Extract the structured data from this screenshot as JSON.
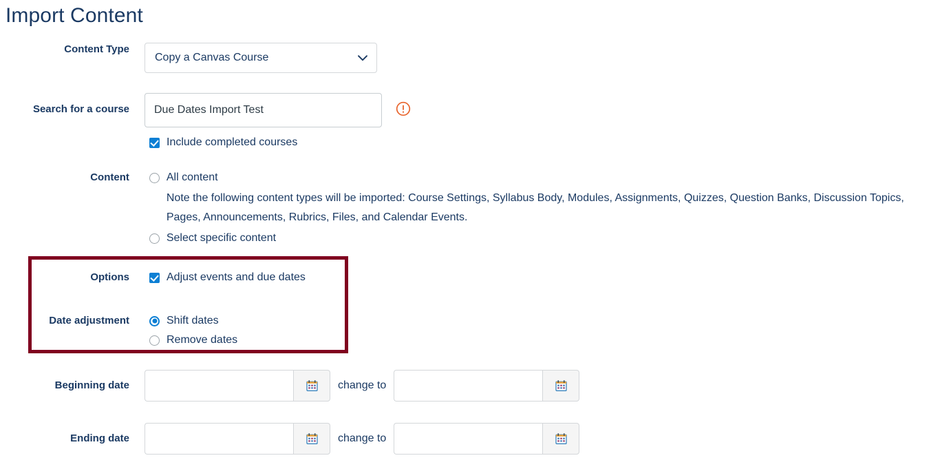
{
  "page": {
    "title": "Import Content"
  },
  "colors": {
    "text_navy": "#1b3a63",
    "accent_blue": "#0c7fd4",
    "highlight_border": "#80011f",
    "warning_orange": "#e8642c"
  },
  "form": {
    "content_type": {
      "label": "Content Type",
      "selected": "Copy a Canvas Course",
      "chevron_icon": "chevron-down-icon"
    },
    "search_course": {
      "label": "Search for a course",
      "value": "Due Dates Import Test",
      "placeholder": "",
      "warning_icon": "warning-circle-icon",
      "include_completed": {
        "label": "Include completed courses",
        "checked": true
      }
    },
    "content": {
      "label": "Content",
      "options": [
        {
          "label": "All content",
          "selected": false
        },
        {
          "label": "Select specific content",
          "selected": false
        }
      ],
      "note": "Note the following content types will be imported: Course Settings, Syllabus Body, Modules, Assignments, Quizzes, Question Banks, Discussion Topics, Pages, Announcements, Rubrics, Files, and Calendar Events."
    },
    "options": {
      "label": "Options",
      "adjust_dates": {
        "label": "Adjust events and due dates",
        "checked": true
      }
    },
    "date_adjustment": {
      "label": "Date adjustment",
      "options": [
        {
          "label": "Shift dates",
          "selected": true
        },
        {
          "label": "Remove dates",
          "selected": false
        }
      ]
    },
    "beginning_date": {
      "label": "Beginning date",
      "from_value": "",
      "to_value": "",
      "change_to_label": "change to",
      "calendar_icon": "calendar-icon"
    },
    "ending_date": {
      "label": "Ending date",
      "from_value": "",
      "to_value": "",
      "change_to_label": "change to",
      "calendar_icon": "calendar-icon"
    }
  }
}
